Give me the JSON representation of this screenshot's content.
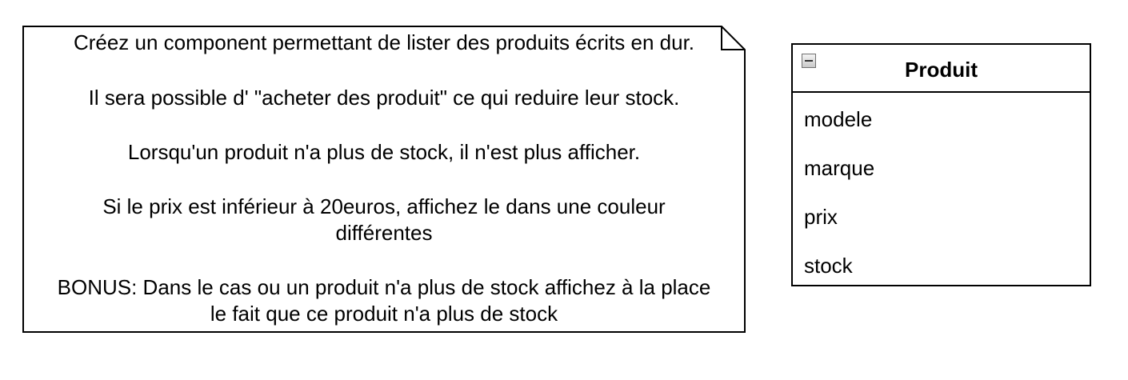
{
  "note": {
    "line_1": "Créez un component permettant de lister des produits écrits en dur.",
    "line_2": "Il sera possible d' \"acheter des produit\" ce qui reduire leur stock.",
    "line_3": "Lorsqu'un produit n'a plus de stock, il n'est plus afficher.",
    "line_4a": "Si le prix est inférieur à 20euros, affichez le dans une couleur",
    "line_4b": "différentes",
    "line_5a": "BONUS: Dans le cas ou un produit n'a plus de stock affichez à la place",
    "line_5b": "le fait que ce produit n'a plus de stock"
  },
  "class": {
    "title": "Produit",
    "attributes": [
      "modele",
      "marque",
      "prix",
      "stock"
    ]
  }
}
